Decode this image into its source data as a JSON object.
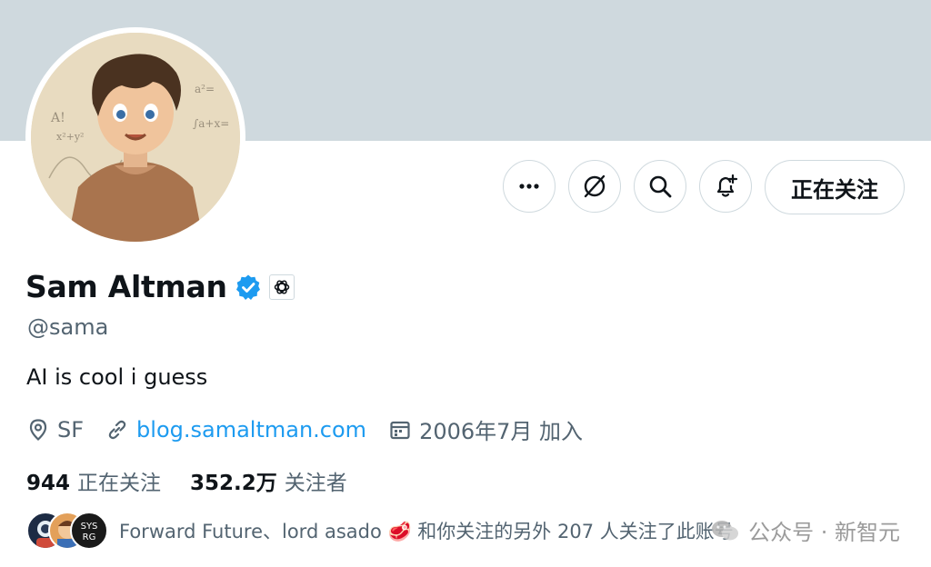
{
  "profile": {
    "name": "Sam Altman",
    "handle": "@sama",
    "bio": "AI is cool i guess",
    "location": "SF",
    "website": "blog.samaltman.com",
    "joined": "2006年7月 加入"
  },
  "actions": {
    "follow_label": "正在关注"
  },
  "stats": {
    "following_count": "944",
    "following_label": "正在关注",
    "followers_count": "352.2万",
    "followers_label": "关注者"
  },
  "mutual": {
    "text": "Forward Future、lord asado 🥩 和你关注的另外 207 人关注了此账号"
  },
  "watermark": {
    "text": "公众号 · 新智元"
  },
  "colors": {
    "banner": "#cfd9de",
    "link": "#1d9bf0",
    "verified": "#1d9bf0",
    "secondary_text": "#536471"
  }
}
